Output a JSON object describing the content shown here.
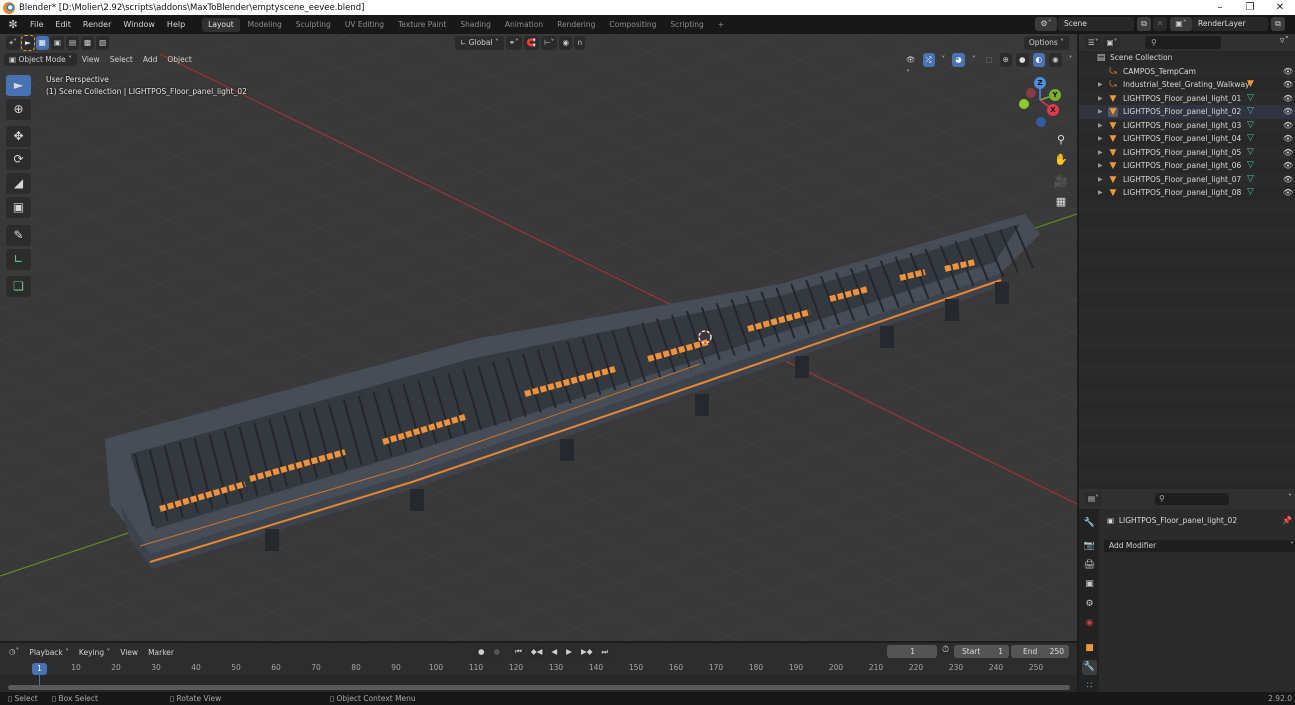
{
  "window": {
    "title": "Blender* [D:\\Molier\\2.92\\scripts\\addons\\MaxToBlender\\emptyscene_eevee.blend]",
    "controls": [
      "minimize",
      "restore",
      "close"
    ]
  },
  "topbar": {
    "menus": [
      "File",
      "Edit",
      "Render",
      "Window",
      "Help"
    ],
    "workspaces": [
      "Layout",
      "Modeling",
      "Sculpting",
      "UV Editing",
      "Texture Paint",
      "Shading",
      "Animation",
      "Rendering",
      "Compositing",
      "Scripting"
    ],
    "active_workspace": "Layout",
    "add_workspace": "+",
    "scene": "Scene",
    "view_layer": "RenderLayer"
  },
  "viewport": {
    "header": {
      "transform_orientation": "Global",
      "options_label": "Options"
    },
    "mode_row": {
      "mode": "Object Mode",
      "menus": [
        "View",
        "Select",
        "Add",
        "Object"
      ]
    },
    "info": {
      "perspective": "User Perspective",
      "context": "(1) Scene Collection | LIGHTPOS_Floor_panel_light_02"
    },
    "gizmo_axes": {
      "x": "X",
      "y": "Y",
      "z": "Z"
    },
    "colors": {
      "background": "#3a3a3a",
      "grid": "#454545",
      "x_axis": "#c0393e",
      "y_axis": "#6c9a2a",
      "accent_orange": "#f0923a",
      "metal": "#4b515b"
    },
    "tools": [
      "select-box",
      "cursor",
      "move",
      "rotate",
      "scale",
      "transform",
      "annotate",
      "measure",
      "add-cube"
    ],
    "nav_buttons": [
      "zoom",
      "pan",
      "camera",
      "ortho-toggle"
    ]
  },
  "outliner": {
    "search_placeholder": "",
    "root": "Scene Collection",
    "items": [
      {
        "name": "CAMPOS_TempCam",
        "type": "empty",
        "expandable": false,
        "has_mesh": false,
        "modifier_badge": false
      },
      {
        "name": "Industrial_Steel_Grating_Walkway",
        "type": "empty",
        "expandable": true,
        "has_mesh": false,
        "modifier_badge": true
      },
      {
        "name": "LIGHTPOS_Floor_panel_light_01",
        "type": "mesh",
        "expandable": true,
        "has_mesh": true
      },
      {
        "name": "LIGHTPOS_Floor_panel_light_02",
        "type": "mesh",
        "expandable": true,
        "has_mesh": true,
        "selected": true
      },
      {
        "name": "LIGHTPOS_Floor_panel_light_03",
        "type": "mesh",
        "expandable": true,
        "has_mesh": true
      },
      {
        "name": "LIGHTPOS_Floor_panel_light_04",
        "type": "mesh",
        "expandable": true,
        "has_mesh": true
      },
      {
        "name": "LIGHTPOS_Floor_panel_light_05",
        "type": "mesh",
        "expandable": true,
        "has_mesh": true
      },
      {
        "name": "LIGHTPOS_Floor_panel_light_06",
        "type": "mesh",
        "expandable": true,
        "has_mesh": true
      },
      {
        "name": "LIGHTPOS_Floor_panel_light_07",
        "type": "mesh",
        "expandable": true,
        "has_mesh": true
      },
      {
        "name": "LIGHTPOS_Floor_panel_light_08",
        "type": "mesh",
        "expandable": true,
        "has_mesh": true
      }
    ]
  },
  "properties": {
    "search_placeholder": "",
    "object_name": "LIGHTPOS_Floor_panel_light_02",
    "add_modifier_label": "Add Modifier",
    "active_tab": "modifiers",
    "tabs": [
      "tool",
      "render",
      "output",
      "view-layer",
      "scene",
      "world",
      "object",
      "modifiers",
      "particles"
    ]
  },
  "timeline": {
    "menus": [
      "Playback",
      "Keying",
      "View",
      "Marker"
    ],
    "current_frame": "1",
    "start_label": "Start",
    "start": "1",
    "end_label": "End",
    "end": "250",
    "ruler_ticks": [
      "10",
      "20",
      "30",
      "40",
      "50",
      "60",
      "70",
      "80",
      "90",
      "100",
      "110",
      "120",
      "130",
      "140",
      "150",
      "160",
      "170",
      "180",
      "190",
      "200",
      "210",
      "220",
      "230",
      "240",
      "250"
    ],
    "playhead_label": "1"
  },
  "statusbar": {
    "items": [
      "Select",
      "Box Select",
      "Rotate View",
      "Object Context Menu"
    ],
    "version": "2.92.0"
  }
}
